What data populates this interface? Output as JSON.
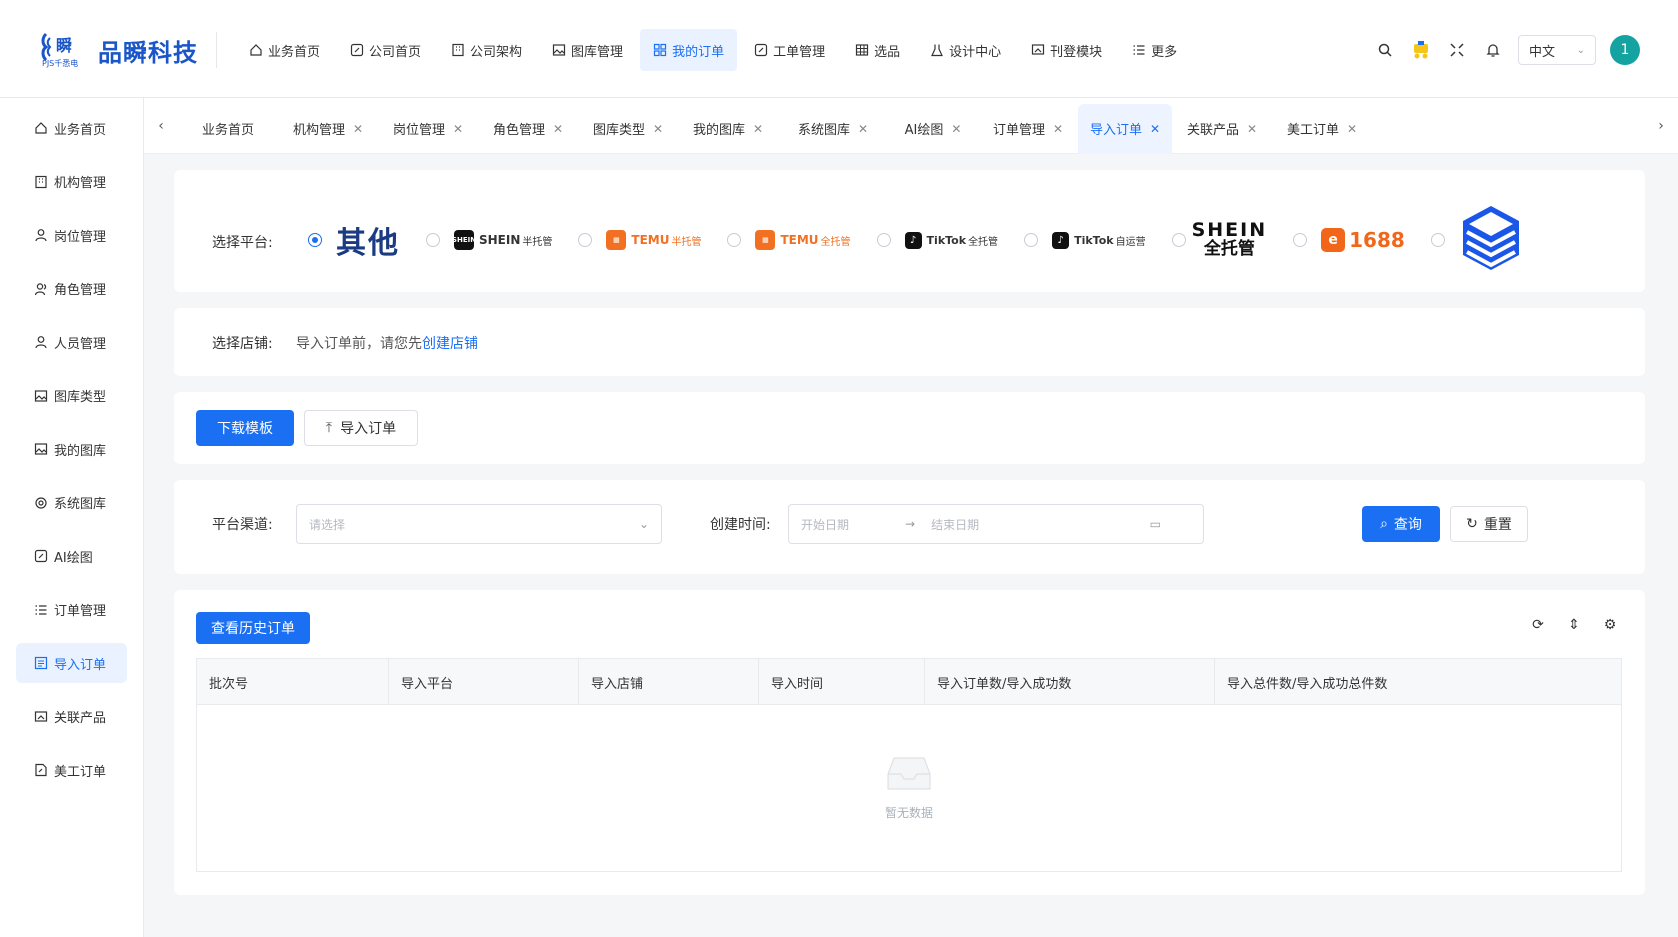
{
  "brand": {
    "name": "品瞬科技",
    "mark": "瞬",
    "tagline": "PJS千悉电"
  },
  "topnav": [
    {
      "label": "业务首页",
      "icon": "home-icon"
    },
    {
      "label": "公司首页",
      "icon": "edit-icon"
    },
    {
      "label": "公司架构",
      "icon": "building-icon"
    },
    {
      "label": "图库管理",
      "icon": "image-icon"
    },
    {
      "label": "我的订单",
      "icon": "grid-icon",
      "active": true
    },
    {
      "label": "工单管理",
      "icon": "edit-icon"
    },
    {
      "label": "选品",
      "icon": "table-icon"
    },
    {
      "label": "设计中心",
      "icon": "flask-icon"
    },
    {
      "label": "刊登模块",
      "icon": "image-edit-icon"
    },
    {
      "label": "更多",
      "icon": "list-icon"
    }
  ],
  "header": {
    "language": "中文",
    "avatar_text": "1"
  },
  "sidebar": [
    {
      "label": "业务首页",
      "icon": "home-icon"
    },
    {
      "label": "机构管理",
      "icon": "building-icon"
    },
    {
      "label": "岗位管理",
      "icon": "user-icon"
    },
    {
      "label": "角色管理",
      "icon": "users-icon"
    },
    {
      "label": "人员管理",
      "icon": "user-icon"
    },
    {
      "label": "图库类型",
      "icon": "image-icon"
    },
    {
      "label": "我的图库",
      "icon": "image-icon"
    },
    {
      "label": "系统图库",
      "icon": "settings-icon"
    },
    {
      "label": "AI绘图",
      "icon": "edit-icon"
    },
    {
      "label": "订单管理",
      "icon": "list-icon"
    },
    {
      "label": "导入订单",
      "icon": "import-list-icon",
      "active": true
    },
    {
      "label": "关联产品",
      "icon": "image-edit-icon"
    },
    {
      "label": "美工订单",
      "icon": "doc-edit-icon"
    }
  ],
  "tabs": [
    {
      "label": "业务首页",
      "closable": false
    },
    {
      "label": "机构管理",
      "closable": true
    },
    {
      "label": "岗位管理",
      "closable": true
    },
    {
      "label": "角色管理",
      "closable": true
    },
    {
      "label": "图库类型",
      "closable": true
    },
    {
      "label": "我的图库",
      "closable": true
    },
    {
      "label": "系统图库",
      "closable": true
    },
    {
      "label": "AI绘图",
      "closable": true
    },
    {
      "label": "订单管理",
      "closable": true
    },
    {
      "label": "导入订单",
      "closable": true,
      "active": true
    },
    {
      "label": "关联产品",
      "closable": true
    },
    {
      "label": "美工订单",
      "closable": true
    }
  ],
  "platform": {
    "label": "选择平台:",
    "options": {
      "other": "其他",
      "shein_half": {
        "name": "SHEIN",
        "sub": "半托管"
      },
      "temu_half": {
        "name": "TEMU",
        "sub": "半托管"
      },
      "temu_full": {
        "name": "TEMU",
        "sub": "全托管"
      },
      "tiktok_full": {
        "name": "TikTok",
        "sub": "全托管"
      },
      "tiktok_self": {
        "name": "TikTok",
        "sub": "自运营"
      },
      "shein_full": {
        "name": "SHEIN",
        "sub": "全托管"
      },
      "num_1688": "1688"
    },
    "selected": "其他"
  },
  "shop": {
    "label": "选择店铺:",
    "hint": "导入订单前，请您先",
    "link": "创建店铺"
  },
  "actions": {
    "download": "下载模板",
    "import": "导入订单"
  },
  "filters": {
    "channel_label": "平台渠道:",
    "channel_placeholder": "请选择",
    "time_label": "创建时间:",
    "start_placeholder": "开始日期",
    "end_placeholder": "结束日期",
    "query": "查询",
    "reset": "重置"
  },
  "table": {
    "history_button": "查看历史订单",
    "columns": [
      "批次号",
      "导入平台",
      "导入店铺",
      "导入时间",
      "导入订单数/导入成功数",
      "导入总件数/导入成功总件数"
    ],
    "empty_text": "暂无数据"
  },
  "colors": {
    "primary": "#1a6ff2",
    "brand": "#1a56c8",
    "temu": "#f27022",
    "alibaba": "#f2661a"
  }
}
